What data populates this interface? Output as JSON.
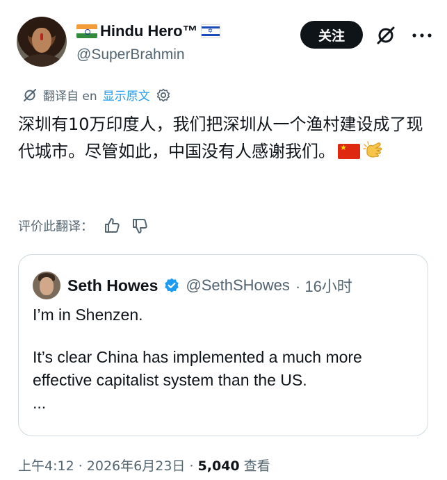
{
  "author": {
    "display_name": "Hindu Hero™",
    "handle": "@SuperBrahmin"
  },
  "actions": {
    "follow_label": "关注",
    "grok_icon": "grok-icon",
    "more_icon": "more-icon"
  },
  "translation_bar": {
    "label": "翻译自 en",
    "show_original": "显示原文"
  },
  "post": {
    "text": "深圳有10万印度人，我们把深圳从一个渔村建设成了现代城市。尽管如此，中国没有人感谢我们。"
  },
  "rate_translation": {
    "label": "评价此翻译："
  },
  "quoted_post": {
    "name": "Seth Howes",
    "handle": "@SethSHowes",
    "time": "· 16小时",
    "line1": "I’m in Shenzen.",
    "line2": "It’s clear China has implemented a much more effective capitalist system than the US.",
    "ellipsis": "..."
  },
  "meta": {
    "time_date": "上午4:12 · 2026年6月23日 · ",
    "views_count": "5,040",
    "views_label": " 查看"
  },
  "colors": {
    "text": "#0f1419",
    "secondary": "#536471",
    "link": "#1d9bf0",
    "border": "#cfd9de"
  }
}
